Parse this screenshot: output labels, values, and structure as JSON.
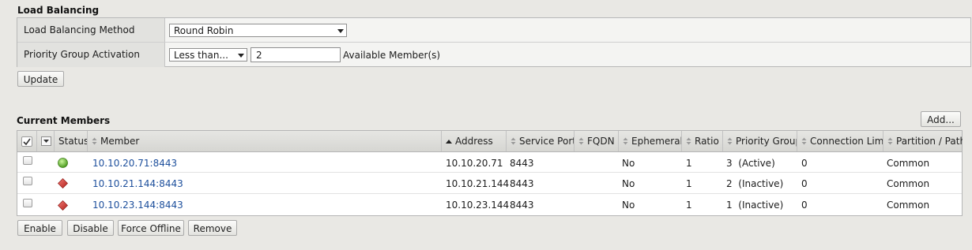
{
  "load_balancing": {
    "title": "Load Balancing",
    "method_label": "Load Balancing Method",
    "method_value": "Round Robin",
    "priority_label": "Priority Group Activation",
    "priority_select": "Less than...",
    "priority_value": "2",
    "available_members_label": "Available Member(s)",
    "update_button": "Update"
  },
  "members": {
    "title": "Current Members",
    "add_button": "Add...",
    "columns": [
      "Status",
      "Member",
      "Address",
      "Service Port",
      "FQDN",
      "Ephemeral",
      "Ratio",
      "Priority Group",
      "Connection Limit",
      "Partition / Path"
    ],
    "rows": [
      {
        "status": "up",
        "status_color": "#5fae2e",
        "member": "10.10.20.71:8443",
        "address": "10.10.20.71",
        "port": "8443",
        "fqdn": "",
        "ephemeral": "No",
        "ratio": "1",
        "priority": "3  (Active)",
        "connection_limit": "0",
        "partition": "Common"
      },
      {
        "status": "down",
        "status_color": "#d2322f",
        "member": "10.10.21.144:8443",
        "address": "10.10.21.144",
        "port": "8443",
        "fqdn": "",
        "ephemeral": "No",
        "ratio": "1",
        "priority": "2  (Inactive)",
        "connection_limit": "0",
        "partition": "Common"
      },
      {
        "status": "down",
        "status_color": "#d2322f",
        "member": "10.10.23.144:8443",
        "address": "10.10.23.144",
        "port": "8443",
        "fqdn": "",
        "ephemeral": "No",
        "ratio": "1",
        "priority": "1  (Inactive)",
        "connection_limit": "0",
        "partition": "Common"
      }
    ],
    "actions": {
      "enable": "Enable",
      "disable": "Disable",
      "force_offline": "Force Offline",
      "remove": "Remove"
    }
  }
}
